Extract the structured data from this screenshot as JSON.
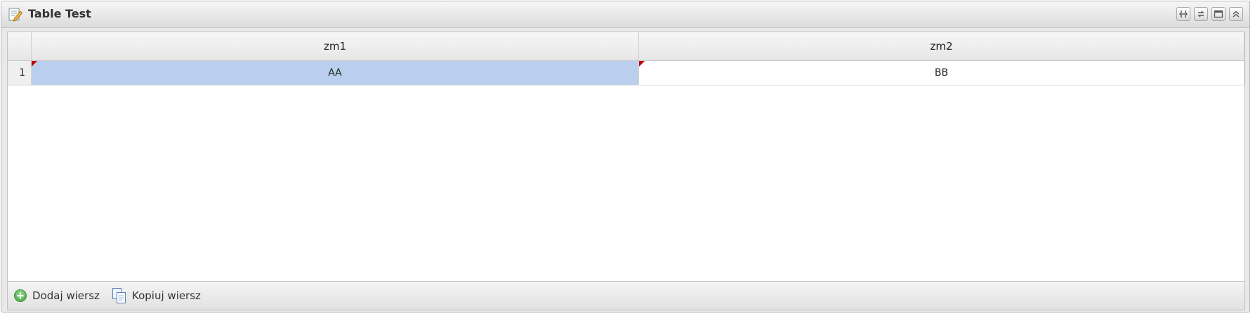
{
  "window": {
    "title": "Table Test",
    "title_icon": "edit-document-icon",
    "tools": [
      {
        "name": "fit-columns-icon"
      },
      {
        "name": "refresh-icon"
      },
      {
        "name": "maximize-icon"
      },
      {
        "name": "collapse-icon"
      }
    ]
  },
  "table": {
    "columns": [
      "zm1",
      "zm2"
    ],
    "rows": [
      {
        "num": "1",
        "cells": [
          "AA",
          "BB"
        ],
        "dirty": [
          true,
          true
        ],
        "selected_cell": 0
      }
    ]
  },
  "footer": {
    "add_label": "Dodaj wiersz",
    "copy_label": "Kopiuj wiersz"
  },
  "colors": {
    "selected_cell": "#b9cfed",
    "dirty_marker": "#c00000",
    "add_icon": "#4caf50"
  }
}
